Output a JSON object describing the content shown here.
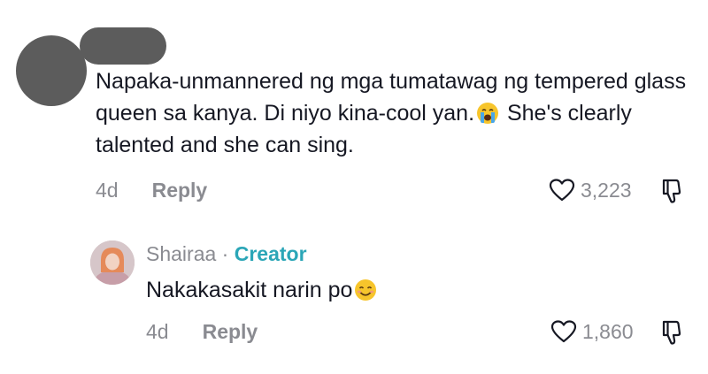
{
  "comment": {
    "text_part1": "Napaka-unmannered ng mga tumatawag ng tempered glass queen sa kanya. Di niyo kina-cool yan.",
    "emoji_icon": "crying-face-icon",
    "text_part2": " She's clearly talented and she can sing.",
    "time": "4d",
    "reply_label": "Reply",
    "like_count": "3,223"
  },
  "reply": {
    "author": "Shairaa",
    "separator": "·",
    "badge": "Creator",
    "text": "Nakakasakit narin po",
    "emoji_icon": "smiling-face-icon",
    "time": "4d",
    "reply_label": "Reply",
    "like_count": "1,860",
    "badge_color": "#2ba6b7"
  },
  "colors": {
    "text": "#161823",
    "muted": "#8a8b91",
    "redaction": "#5c5c5c"
  }
}
